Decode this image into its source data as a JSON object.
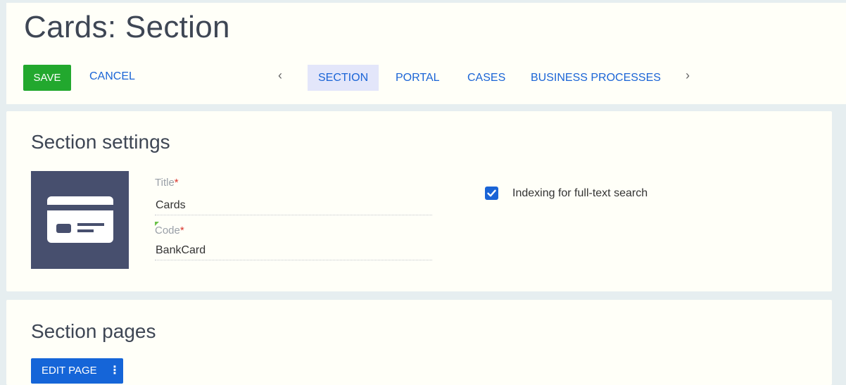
{
  "header": {
    "title": "Cards: Section",
    "save_label": "SAVE",
    "cancel_label": "CANCEL",
    "prev_arrow": "‹",
    "next_arrow": "›",
    "tabs": [
      {
        "label": "SECTION",
        "active": true
      },
      {
        "label": "PORTAL",
        "active": false
      },
      {
        "label": "CASES",
        "active": false
      },
      {
        "label": "BUSINESS PROCESSES",
        "active": false
      }
    ]
  },
  "settings": {
    "heading": "Section settings",
    "image_icon": "credit-card-icon",
    "title_label": "Title",
    "title_value": "Cards",
    "code_label": "Code",
    "code_value": "BankCard",
    "required_mark": "*",
    "indexing_label": "Indexing for full-text search",
    "indexing_checked": true
  },
  "pages": {
    "heading": "Section pages",
    "edit_page_label": "EDIT PAGE",
    "menu_glyph": "⋮"
  },
  "colors": {
    "accent_blue": "#1a64d6",
    "save_green": "#22a82e",
    "image_bg": "#474f6e",
    "required_red": "#d9342b"
  }
}
